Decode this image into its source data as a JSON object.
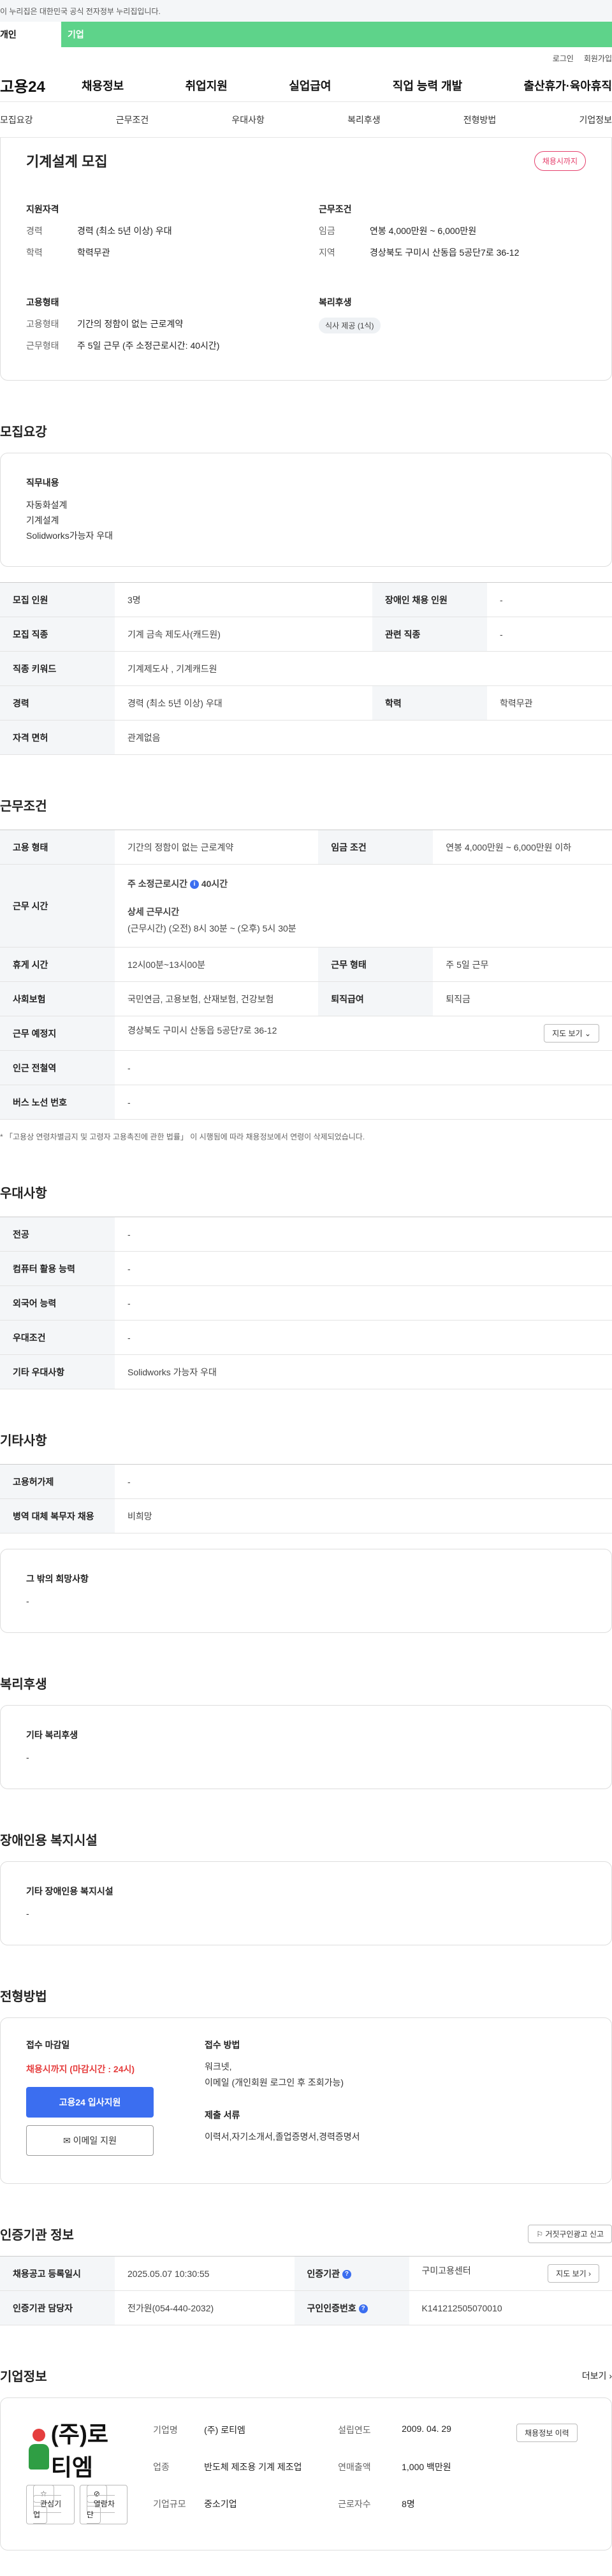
{
  "top_strip": "이 누리집은 대한민국 공식 전자정부 누리집입니다.",
  "user_tabs": [
    "개인",
    "기업"
  ],
  "utility": [
    "로그인",
    "회원가입"
  ],
  "logo": "고용24",
  "gnb": [
    "채용정보",
    "취업지원",
    "실업급여",
    "직업 능력 개발",
    "출산휴가·육아휴직"
  ],
  "subnav": [
    "모집요강",
    "근무조건",
    "우대사항",
    "복리후생",
    "전형방법",
    "기업정보"
  ],
  "summary": {
    "title": "기계설계 모집",
    "badge": "채용시까지",
    "qual_title": "지원자격",
    "qual": [
      {
        "k": "경력",
        "v": "경력 (최소 5년 이상) 우대"
      },
      {
        "k": "학력",
        "v": "학력무관"
      }
    ],
    "cond_title": "근무조건",
    "cond": [
      {
        "k": "임금",
        "v": "연봉 4,000만원 ~ 6,000만원"
      },
      {
        "k": "지역",
        "v": "경상북도 구미시 산동읍 5공단7로 36-12"
      }
    ],
    "emp_title": "고용형태",
    "emp": [
      {
        "k": "고용형태",
        "v": "기간의 정함이 없는 근로계약"
      },
      {
        "k": "근무형태",
        "v": "주 5일 근무 (주 소정근로시간: 40시간)"
      }
    ],
    "welfare_title": "복리후생",
    "welfare_chip": "식사 제공 (1식)"
  },
  "recruit": {
    "title": "모집요강",
    "duty_title": "직무내용",
    "duty_lines": [
      "자동화설계",
      "기계설계",
      "Solidworks가능자 우대"
    ],
    "rows": [
      {
        "k1": "모집 인원",
        "v1": "3명",
        "k2": "장애인 채용 인원",
        "v2": "-"
      },
      {
        "k1": "모집 직종",
        "v1": "기계 금속 제도사(캐드원)",
        "k2": "관련 직종",
        "v2": "-"
      },
      {
        "k1": "직종 키워드",
        "v1": "기계제도사 , 기계캐드원"
      },
      {
        "k1": "경력",
        "v1": "경력 (최소 5년 이상) 우대",
        "k2": "학력",
        "v2": "학력무관"
      },
      {
        "k1": "자격 면허",
        "v1": "관계없음"
      }
    ]
  },
  "work": {
    "title": "근무조건",
    "emp_type_k": "고용 형태",
    "emp_type_v": "기간의 정함이 없는 근로계약",
    "wage_k": "임금 조건",
    "wage_v": "연봉 4,000만원 ~ 6,000만원 이하",
    "hours_k": "근무 시간",
    "hours_weekly": "주 소정근로시간",
    "hours_weekly_val": "40시간",
    "hours_detail_title": "상세 근무시간",
    "hours_detail": "(근무시간) (오전) 8시 30분 ~ (오후) 5시 30분",
    "break_k": "휴게 시간",
    "break_v": "12시00분~13시00분",
    "form_k": "근무 형태",
    "form_v": "주 5일 근무",
    "ins_k": "사회보험",
    "ins_v": "국민연금, 고용보험, 산재보험, 건강보험",
    "sev_k": "퇴직급여",
    "sev_v": "퇴직금",
    "place_k": "근무 예정지",
    "place_v": "경상북도 구미시 산동읍 5공단7로 36-12",
    "map_btn": "지도 보기",
    "subway_k": "인근 전철역",
    "subway_v": "-",
    "bus_k": "버스 노선 번호",
    "bus_v": "-",
    "note": "「고용상 연령차별금지 및 고령자 고용촉진에 관한 법률」 이 시행됨에 따라 채용정보에서 연령이 삭제되었습니다."
  },
  "pref": {
    "title": "우대사항",
    "rows": [
      {
        "k": "전공",
        "v": "-"
      },
      {
        "k": "컴퓨터 활용 능력",
        "v": "-"
      },
      {
        "k": "외국어 능력",
        "v": "-"
      },
      {
        "k": "우대조건",
        "v": "-"
      },
      {
        "k": "기타 우대사항",
        "v": "Solidworks 가능자 우대"
      }
    ]
  },
  "other": {
    "title": "기타사항",
    "rows": [
      {
        "k": "고용허가제",
        "v": "-"
      },
      {
        "k": "병역 대체 복무자 채용",
        "v": "비희망"
      }
    ],
    "card_title": "그 밖의 희망사항",
    "card_value": "-"
  },
  "welfare": {
    "title": "복리후생",
    "card_title": "기타 복리후생",
    "card_value": "-"
  },
  "disabled": {
    "title": "장애인용 복지시설",
    "card_title": "기타 장애인용 복지시설",
    "card_value": "-"
  },
  "apply": {
    "title": "전형방법",
    "deadline_title": "접수 마감일",
    "deadline": "채용시까지 (마감시간 : 24시)",
    "apply_btn": "고용24 입사지원",
    "email_btn": "이메일 지원",
    "method_title": "접수 방법",
    "method_lines": [
      "워크넷,",
      "이메일 (개인회원 로그인 후 조회가능)"
    ],
    "docs_title": "제출 서류",
    "docs": "이력서,자기소개서,졸업증명서,경력증명서"
  },
  "cert": {
    "title": "인증기관 정보",
    "report_btn": "거짓구인광고 신고",
    "reg_k": "채용공고 등록일시",
    "reg_v": "2025.05.07 10:30:55",
    "agency_k": "인증기관",
    "agency_v": "구미고용센터",
    "map_btn": "지도 보기",
    "manager_k": "인증기관 담당자",
    "manager_v": "전가원(054-440-2032)",
    "no_k": "구인인증번호",
    "no_v": "K141212505070010"
  },
  "company": {
    "title": "기업정보",
    "more": "더보기",
    "logo_text": "(주)로티엠",
    "fav_btn": "관심기업",
    "block_btn": "열람차단",
    "name_k": "기업명",
    "name_v": "(주) 로티엠",
    "industry_k": "업종",
    "industry_v": "반도체 제조용 기계 제조업",
    "size_k": "기업규모",
    "size_v": "중소기업",
    "founded_k": "설립연도",
    "founded_v": "2009. 04. 29",
    "sales_k": "연매출액",
    "sales_v": "1,000 백만원",
    "staff_k": "근로자수",
    "staff_v": "8명",
    "history_btn": "채용정보 이력"
  }
}
